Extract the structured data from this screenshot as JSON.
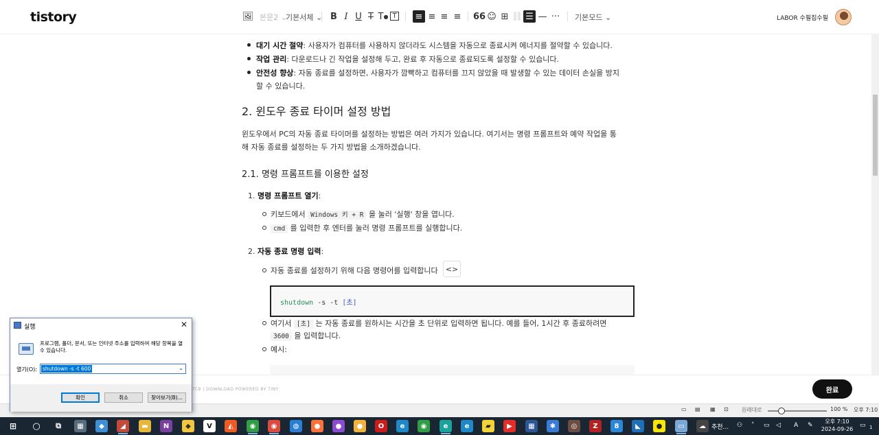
{
  "app": {
    "logo": "tistory",
    "user": "LABOR 수필집수필"
  },
  "toolbar": {
    "image_label": "▣",
    "heading": "본문2",
    "font": "기본서체",
    "mode": "기본모드"
  },
  "content": {
    "bullets_top": [
      {
        "bold": "대기 시간 절약",
        "text": ": 사용자가 컴퓨터를 사용하지 않더라도 시스템을 자동으로 종료시켜 에너지를 절약할 수 있습니다."
      },
      {
        "bold": "작업 관리",
        "text": ": 다운로드나 긴 작업을 설정해 두고, 완료 후 자동으로 종료되도록 설정할 수 있습니다."
      },
      {
        "bold": "안전성 향상",
        "text": ": 자동 종료를 설정하면, 사용자가 깜빡하고 컴퓨터를 끄지 않았을 때 발생할 수 있는 데이터 손실을 방지",
        "text2": "할 수 있습니다."
      }
    ],
    "h2": "2. 윈도우 종료 타이머 설정 방법",
    "intro_1": "윈도우에서 PC의 자동 종료 타이머를 설정하는 방법은 여러 가지가 있습니다. 여기서는 명령 프롬프트와 예약 작업을 통",
    "intro_2": "해 자동 종료를 설정하는 두 가지 방법을 소개하겠습니다.",
    "h3": "2.1. 명령 프롬프트를 이용한 설정",
    "step1_num": "1.",
    "step1_title": "명령 프롬프트 열기",
    "step1_colon": ":",
    "step1_a_pre": "키보드에서",
    "step1_a_code": "Windows 키 + R",
    "step1_a_post": "을 눌러 '실행' 창을 엽니다.",
    "step1_b_code": "cmd",
    "step1_b_post": "를 입력한 후 엔터를 눌러 명령 프롬프트를 실행합니다.",
    "step2_num": "2.",
    "step2_title": "자동 종료 명령 입력",
    "step2_colon": ":",
    "step2_a": "자동 종료를 설정하기 위해 다음 명령어를 입력합니다",
    "code_cmd": "shutdown",
    "code_opts": " -s -t ",
    "code_arg": "[초]",
    "code_icon": "<>",
    "step2_b_pre": "여기서",
    "step2_b_code": "[초]",
    "step2_b_post": "는 자동 종료를 원하시는 시간을 초 단위로 입력하면 됩니다. 예를 들어, 1시간 후 종료하려면",
    "step2_b_code2": "3600",
    "step2_b_post2": "을 입력합니다.",
    "step2_c": "예시:"
  },
  "editor_bottom": {
    "powered": "TC8 | DOWNLOAD      POWERED BY TINY",
    "done": "완료"
  },
  "statusbar": {
    "zoom_label": "원래대로",
    "zoom": "100 %",
    "time_text": "오후 7:10",
    "zoom_level": 0.2
  },
  "taskbar": {
    "search": "추천...",
    "time": "오후 7:10",
    "date": "2024-09-26",
    "lang": "A",
    "notif": "1"
  },
  "run_dialog": {
    "title": "실행",
    "desc": "프로그램, 폴더, 문서, 또는 인터넷 주소를 입력하여 해당 항목을 열 수 있습니다.",
    "label": "열기(O):",
    "value": "shutdown -s -t 600",
    "ok": "확인",
    "cancel": "취소",
    "browse": "찾아보기(B)..."
  },
  "colors": {
    "accent": "#0078d7",
    "taskbar": "#1b2633",
    "done_button": "#111111",
    "code_green": "#2e8b57",
    "code_blue": "#3a55c4"
  }
}
